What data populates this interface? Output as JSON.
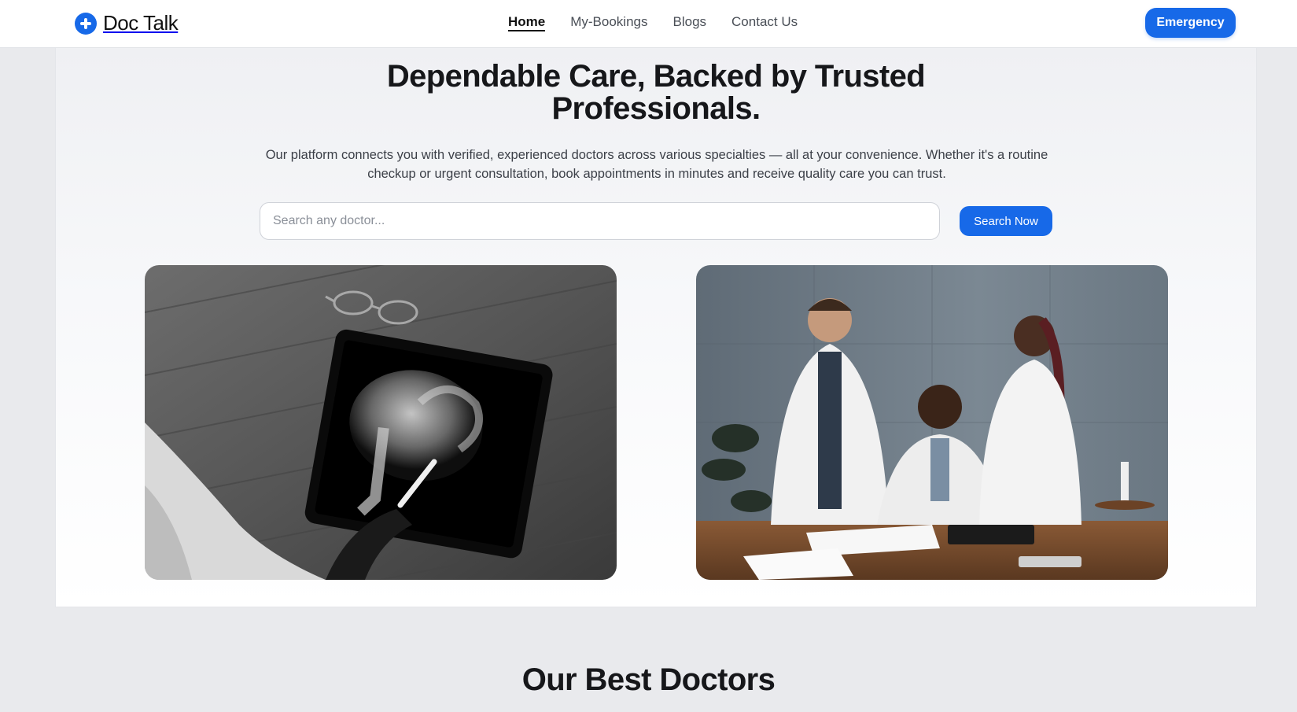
{
  "brand": {
    "name": "Doc Talk",
    "icon": "plus-circle-icon",
    "accent": "#1769e8"
  },
  "nav": {
    "items": [
      {
        "label": "Home",
        "active": true
      },
      {
        "label": "My-Bookings",
        "active": false
      },
      {
        "label": "Blogs",
        "active": false
      },
      {
        "label": "Contact Us",
        "active": false
      }
    ],
    "emergency_label": "Emergency"
  },
  "hero": {
    "title_line1": "Dependable Care, Backed by Trusted",
    "title_line2": "Professionals.",
    "description": "Our platform connects you with verified, experienced doctors across various specialties — all at your convenience. Whether it's a routine checkup or urgent consultation, book appointments in minutes and receive quality care you can trust.",
    "search": {
      "placeholder": "Search any doctor...",
      "value": ""
    },
    "search_button_label": "Search Now",
    "images": [
      {
        "subject": "x-ray-tablet-photo"
      },
      {
        "subject": "doctors-team-photo"
      }
    ]
  },
  "doctors_section": {
    "title": "Our Best Doctors"
  }
}
